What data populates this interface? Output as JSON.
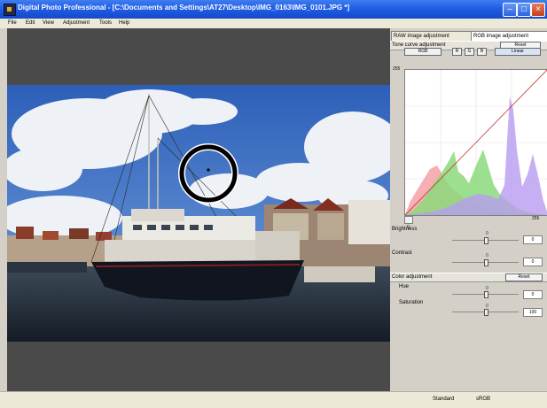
{
  "window": {
    "title": "Digital Photo Professional - [C:\\Documents and Settings\\AT27\\Desktop\\IMG_0163\\IMG_0101.JPG *]"
  },
  "menu": [
    "File",
    "Edit",
    "View",
    "Adjustment",
    "Tools",
    "Help"
  ],
  "panel": {
    "tabs": [
      "RAW image adjustment",
      "RGB image adjustment"
    ],
    "tone_curve": {
      "header": "Tone curve adjustment",
      "reset_label": "Reset",
      "channel_label": "RGB",
      "buttons": [
        "R",
        "G",
        "B"
      ],
      "linear_label": "Linear"
    },
    "histogram": {
      "top_value": "255",
      "bottom_left_value": "0",
      "bottom_right_value": "255"
    },
    "brightness": {
      "label": "Brightness",
      "value": "0",
      "scale_value": "0"
    },
    "contrast": {
      "label": "Contrast",
      "value": "0",
      "scale_value": "0"
    },
    "color_adjustment": {
      "header": "Color adjustment",
      "reset_label": "Reset",
      "hue": {
        "label": "Hue",
        "value": "0",
        "scale_value": "0"
      },
      "saturation": {
        "label": "Saturation",
        "value": "100",
        "scale_value": "0"
      }
    }
  },
  "status": {
    "picture_style": "Standard",
    "color_space": "sRGB"
  },
  "icons": {
    "app": "dpp-app-icon",
    "minimize": "minimize-icon",
    "maximize": "maximize-icon",
    "close": "close-icon"
  },
  "colors": {
    "title_bar": "#1f5ee6",
    "viewer_bg": "#4a4a4a",
    "highlight_ring": "#000000"
  }
}
